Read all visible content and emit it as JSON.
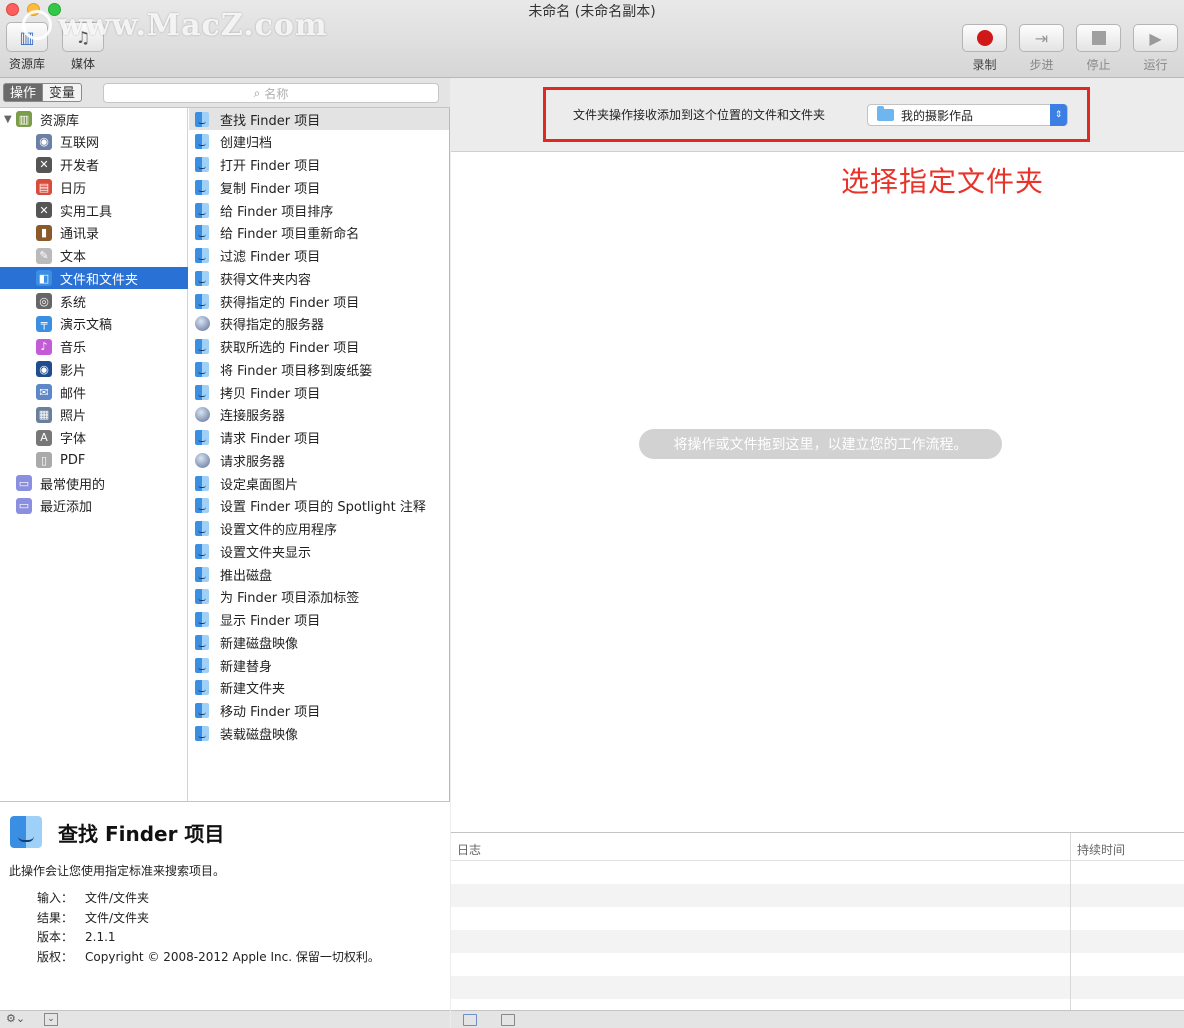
{
  "window": {
    "title": "未命名 (未命名副本)",
    "watermark": "www.MacZ.com"
  },
  "toolbar": {
    "library_label": "资源库",
    "media_label": "媒体",
    "record_label": "录制",
    "step_label": "步进",
    "stop_label": "停止",
    "run_label": "运行"
  },
  "left_panel": {
    "tab_actions": "操作",
    "tab_variables": "变量",
    "search_placeholder": "名称",
    "library_items": [
      {
        "label": "资源库",
        "icon": "library-icon"
      },
      {
        "label": "互联网",
        "icon": "globe-icon"
      },
      {
        "label": "开发者",
        "icon": "tools-icon"
      },
      {
        "label": "日历",
        "icon": "calendar-icon"
      },
      {
        "label": "实用工具",
        "icon": "utilities-icon"
      },
      {
        "label": "通讯录",
        "icon": "contacts-icon"
      },
      {
        "label": "文本",
        "icon": "text-icon"
      },
      {
        "label": "文件和文件夹",
        "icon": "finder-icon"
      },
      {
        "label": "系统",
        "icon": "system-icon"
      },
      {
        "label": "演示文稿",
        "icon": "presentation-icon"
      },
      {
        "label": "音乐",
        "icon": "music-icon"
      },
      {
        "label": "影片",
        "icon": "movie-icon"
      },
      {
        "label": "邮件",
        "icon": "mail-icon"
      },
      {
        "label": "照片",
        "icon": "photos-icon"
      },
      {
        "label": "字体",
        "icon": "fonts-icon"
      },
      {
        "label": "PDF",
        "icon": "pdf-icon"
      },
      {
        "label": "最常使用的",
        "icon": "smart-folder-icon"
      },
      {
        "label": "最近添加",
        "icon": "smart-folder-icon"
      }
    ],
    "selected_library": "文件和文件夹",
    "actions": [
      {
        "label": "查找 Finder 项目",
        "icon": "finder-icon"
      },
      {
        "label": "创建归档",
        "icon": "finder-icon"
      },
      {
        "label": "打开 Finder 项目",
        "icon": "finder-icon"
      },
      {
        "label": "复制 Finder 项目",
        "icon": "finder-icon"
      },
      {
        "label": "给 Finder 项目排序",
        "icon": "finder-icon"
      },
      {
        "label": "给 Finder 项目重新命名",
        "icon": "finder-icon"
      },
      {
        "label": "过滤 Finder 项目",
        "icon": "finder-icon"
      },
      {
        "label": "获得文件夹内容",
        "icon": "finder-icon"
      },
      {
        "label": "获得指定的 Finder 项目",
        "icon": "finder-icon"
      },
      {
        "label": "获得指定的服务器",
        "icon": "globe-icon"
      },
      {
        "label": "获取所选的 Finder 项目",
        "icon": "finder-icon"
      },
      {
        "label": "将 Finder 项目移到废纸篓",
        "icon": "finder-icon"
      },
      {
        "label": "拷贝 Finder 项目",
        "icon": "finder-icon"
      },
      {
        "label": "连接服务器",
        "icon": "globe-icon"
      },
      {
        "label": "请求 Finder 项目",
        "icon": "finder-icon"
      },
      {
        "label": "请求服务器",
        "icon": "globe-icon"
      },
      {
        "label": "设定桌面图片",
        "icon": "finder-icon"
      },
      {
        "label": "设置 Finder 项目的 Spotlight 注释",
        "icon": "finder-icon"
      },
      {
        "label": "设置文件的应用程序",
        "icon": "finder-icon"
      },
      {
        "label": "设置文件夹显示",
        "icon": "finder-icon"
      },
      {
        "label": "推出磁盘",
        "icon": "finder-icon"
      },
      {
        "label": "为 Finder 项目添加标签",
        "icon": "finder-icon"
      },
      {
        "label": "显示 Finder 项目",
        "icon": "finder-icon"
      },
      {
        "label": "新建磁盘映像",
        "icon": "finder-icon"
      },
      {
        "label": "新建替身",
        "icon": "finder-icon"
      },
      {
        "label": "新建文件夹",
        "icon": "finder-icon"
      },
      {
        "label": "移动 Finder 项目",
        "icon": "finder-icon"
      },
      {
        "label": "装载磁盘映像",
        "icon": "finder-icon"
      }
    ],
    "description": {
      "title": "查找 Finder 项目",
      "text": "此操作会让您使用指定标准来搜索项目。",
      "input_key": "输入：",
      "input_val": "文件/文件夹",
      "result_key": "结果：",
      "result_val": "文件/文件夹",
      "version_key": "版本：",
      "version_val": "2.1.1",
      "copyright_key": "版权：",
      "copyright_val": "Copyright © 2008-2012 Apple Inc. 保留一切权利。"
    },
    "footer_gear": "⚙⌄"
  },
  "workflow": {
    "receive_label": "文件夹操作接收添加到这个位置的文件和文件夹",
    "folder_value": "我的摄影作品",
    "annotation": "选择指定文件夹",
    "drop_hint": "将操作或文件拖到这里，以建立您的工作流程。"
  },
  "log": {
    "col_log": "日志",
    "col_duration": "持续时间"
  },
  "colors": {
    "selection": "#2a71d6",
    "annotation_red": "#e8332a",
    "record_red": "#d01818"
  }
}
